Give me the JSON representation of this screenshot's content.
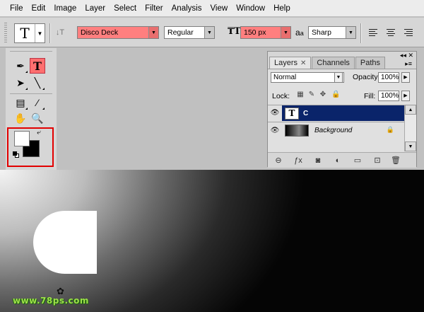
{
  "menu": [
    "File",
    "Edit",
    "Image",
    "Layer",
    "Select",
    "Filter",
    "Analysis",
    "View",
    "Window",
    "Help"
  ],
  "options": {
    "tool_glyph": "T",
    "font_family": "Disco Deck",
    "font_style": "Regular",
    "font_size": "150 px",
    "aa_label": "a",
    "aa_label_small": "a",
    "antialias": "Sharp",
    "highlight_color": "#ff7f7f"
  },
  "toolbox": {
    "active_tool": "T",
    "foreground_color": "#ffffff",
    "background_color": "#000000",
    "highlight_frame_color": "#e20000"
  },
  "layers_panel": {
    "tabs": [
      "Layers",
      "Channels",
      "Paths"
    ],
    "active_tab": "Layers",
    "blend_mode": "Normal",
    "opacity_label": "Opacity:",
    "opacity": "100%",
    "lock_label": "Lock:",
    "fill_label": "Fill:",
    "fill": "100%",
    "layers": [
      {
        "name": "C",
        "kind": "text",
        "selected": true
      },
      {
        "name": "Background",
        "kind": "image",
        "selected": false,
        "locked": true
      }
    ],
    "selection_color": "#0a246a"
  },
  "canvas": {
    "text_glyph": "C",
    "watermark": "www.78ps.com",
    "watermark_color": "#9fe04a"
  }
}
